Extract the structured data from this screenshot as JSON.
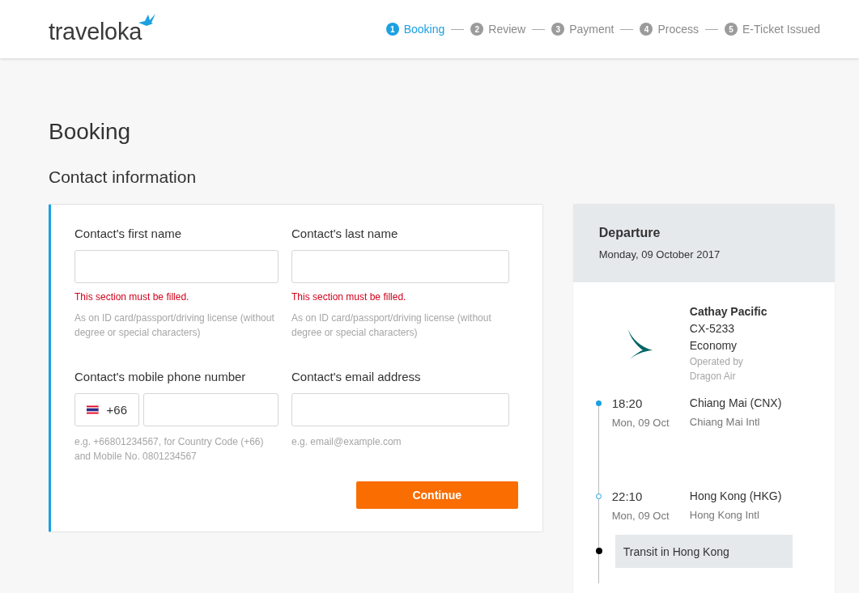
{
  "header": {
    "logo": "traveloka",
    "steps": [
      {
        "number": "1",
        "label": "Booking",
        "selected": true
      },
      {
        "number": "2",
        "label": "Review",
        "selected": false
      },
      {
        "number": "3",
        "label": "Payment",
        "selected": false
      },
      {
        "number": "4",
        "label": "Process",
        "selected": false
      },
      {
        "number": "5",
        "label": "E-Ticket Issued",
        "selected": false
      }
    ]
  },
  "page_title": "Booking",
  "section_title": "Contact information",
  "contact_form": {
    "fields": [
      {
        "kind": "text",
        "label": "Contact's first name",
        "error": "This section must be filled.",
        "hint": "As on ID card/passport/driving license (without degree or special characters)"
      },
      {
        "kind": "text",
        "label": "Contact's last name",
        "error": "This section must be filled.",
        "hint": "As on ID card/passport/driving license (without degree or special characters)"
      },
      {
        "kind": "phone",
        "label": "Contact's mobile phone number",
        "country_code": "+66",
        "hint": "e.g. +66801234567, for Country Code (+66) and Mobile No. 0801234567"
      },
      {
        "kind": "text",
        "label": "Contact's email address",
        "hint": "e.g. email@example.com"
      }
    ],
    "submit": "Continue"
  },
  "flight_summary": {
    "title": "Departure",
    "date": "Monday, 09 October 2017",
    "airline": "Cathay Pacific",
    "flight_number": "CX-5233",
    "cabin": "Economy",
    "operated_by": "Operated by Dragon Air",
    "stops": [
      {
        "kind": "departure",
        "time": "18:20",
        "date": "Mon, 09 Oct",
        "place": "Chiang Mai (CNX)",
        "airport": "Chiang Mai Intl"
      },
      {
        "kind": "arrival",
        "time": "22:10",
        "date": "Mon, 09 Oct",
        "place": "Hong Kong (HKG)",
        "airport": "Hong Kong Intl"
      },
      {
        "kind": "transit",
        "text": "Transit in Hong Kong"
      }
    ]
  }
}
